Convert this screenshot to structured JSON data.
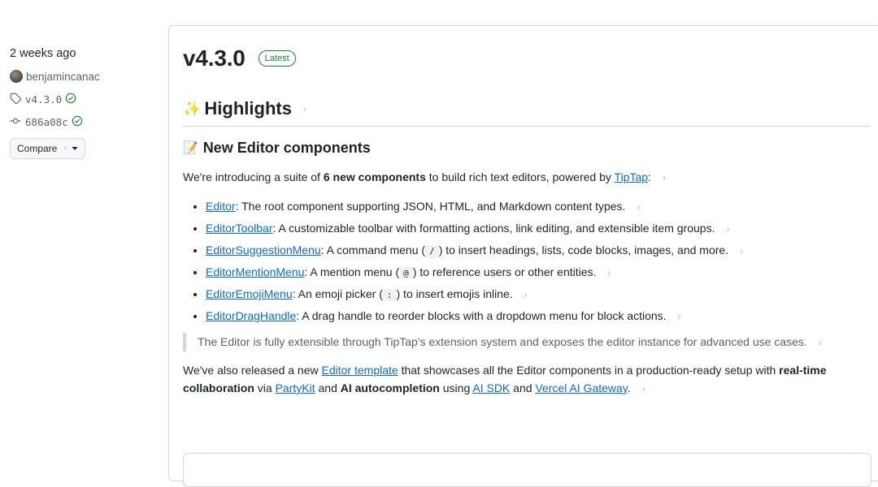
{
  "meta": {
    "date": "2 weeks ago",
    "author": "benjamincanac",
    "tag": "v4.3.0",
    "commit": "686a08c",
    "compare_label": "Compare"
  },
  "release": {
    "title": "v4.3.0",
    "badge": "Latest",
    "highlights_icon": "✨",
    "highlights_heading": "Highlights",
    "section_icon": "📝",
    "section_heading": "New Editor components",
    "intro": {
      "pre": "We're introducing a suite of ",
      "bold": "6 new components",
      "mid": " to build rich text editors, powered by ",
      "link": "TipTap",
      "post": ":"
    },
    "items": [
      {
        "link": "Editor",
        "text": ": The root component supporting JSON, HTML, and Markdown content types."
      },
      {
        "link": "EditorToolbar",
        "text": ": A customizable toolbar with formatting actions, link editing, and extensible item groups."
      },
      {
        "link": "EditorSuggestionMenu",
        "pre": ": A command menu (",
        "code": "/",
        "post": ") to insert headings, lists, code blocks, images, and more."
      },
      {
        "link": "EditorMentionMenu",
        "pre": ": A mention menu (",
        "code": "@",
        "post": ") to reference users or other entities."
      },
      {
        "link": "EditorEmojiMenu",
        "pre": ": An emoji picker (",
        "code": ":",
        "post": ") to insert emojis inline."
      },
      {
        "link": "EditorDragHandle",
        "text": ": A drag handle to reorder blocks with a dropdown menu for block actions."
      }
    ],
    "quote": "The Editor is fully extensible through TipTap's extension system and exposes the editor instance for advanced use cases.",
    "closing": {
      "pre": "We've also released a new ",
      "link1": "Editor template",
      "mid1": " that showcases all the Editor components in a production-ready setup with ",
      "bold1": "real-time collaboration",
      "mid2": " via ",
      "link2": "PartyKit",
      "mid3": " and ",
      "bold2": "AI autocompletion",
      "mid4": " using ",
      "link3": "AI SDK",
      "mid5": " and ",
      "link4": "Vercel AI Gateway",
      "post": "."
    }
  },
  "icons": {
    "anchor": "link-icon",
    "tag": "tag-icon",
    "commit": "git-commit-icon",
    "verified": "verified-check-icon",
    "caret": "triangle-down-icon"
  },
  "colors": {
    "link": "#0969da",
    "badge_green": "#1a7f37",
    "muted": "#59636e",
    "border": "#d1d9e0"
  }
}
